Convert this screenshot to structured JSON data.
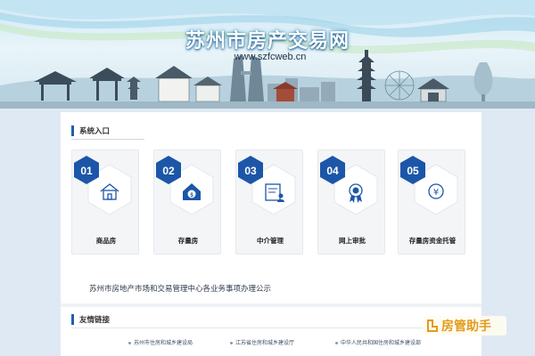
{
  "header": {
    "site_title": "苏州市房产交易网",
    "site_url": "www.szfcweb.cn"
  },
  "system_entry": {
    "title": "系统入口",
    "cards": [
      {
        "number": "01",
        "label": "商品房",
        "icon": "house-icon"
      },
      {
        "number": "02",
        "label": "存量房",
        "icon": "money-house-icon"
      },
      {
        "number": "03",
        "label": "中介管理",
        "icon": "id-card-icon"
      },
      {
        "number": "04",
        "label": "网上审批",
        "icon": "approval-seal-icon"
      },
      {
        "number": "05",
        "label": "存量房资金托管",
        "icon": "yuan-coin-icon"
      }
    ]
  },
  "notice": "苏州市房地产市场和交易管理中心各业务事项办理公示",
  "friendly_links": {
    "title": "友情链接",
    "items": [
      "苏州市住房和城乡建设局",
      "江苏省住房和城乡建设厅",
      "中华人民共和国住房和城乡建设部"
    ]
  },
  "watermark": {
    "text": "房管助手",
    "accent": "#e39a1c"
  },
  "colors": {
    "accent_blue": "#1f5fae",
    "hex_blue": "#1c56a8",
    "panel_bg": "#ffffff",
    "page_bg": "#dfe9f3"
  }
}
